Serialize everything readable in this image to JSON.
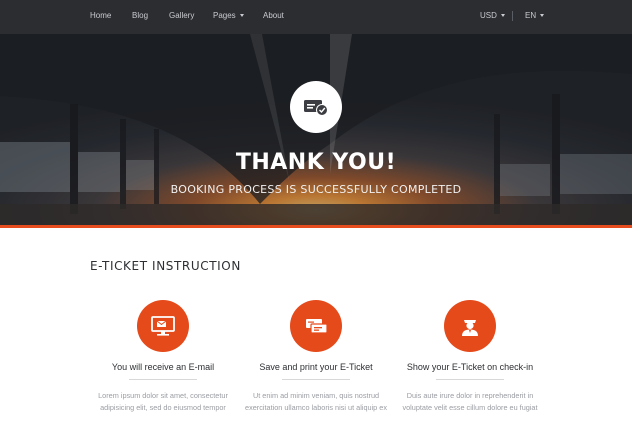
{
  "nav": {
    "items": [
      {
        "label": "Home"
      },
      {
        "label": "Blog"
      },
      {
        "label": "Gallery"
      },
      {
        "label": "Pages",
        "has_dropdown": true
      }
    ],
    "about": "About",
    "currency": "USD",
    "language": "EN"
  },
  "hero": {
    "title": "THANK YOU!",
    "subtitle": "BOOKING PROCESS IS SUCCESSFULLY COMPLETED",
    "icon": "ticket-check-icon"
  },
  "instructions": {
    "title": "E-TICKET INSTRUCTION",
    "steps": [
      {
        "icon": "monitor-email-icon",
        "title": "You will receive an E-mail",
        "text_line1": "Lorem ipsum dolor sit amet, consectetur",
        "text_line2": "adipisicing elit, sed do eiusmod tempor"
      },
      {
        "icon": "tickets-icon",
        "title": "Save and print your E-Ticket",
        "text_line1": "Ut enim ad minim veniam, quis nostrud",
        "text_line2": "exercitation ullamco laboris nisi ut aliquip ex"
      },
      {
        "icon": "checkin-agent-icon",
        "title": "Show your E-Ticket on check-in",
        "text_line1": "Duis aute irure dolor in reprehenderit in",
        "text_line2": "voluptate velit esse cillum dolore eu fugiat"
      }
    ]
  },
  "colors": {
    "accent": "#e54a1b",
    "navbar": "#2b2d31",
    "heading_text": "#2d2f33",
    "muted_text": "#9a9da3"
  }
}
